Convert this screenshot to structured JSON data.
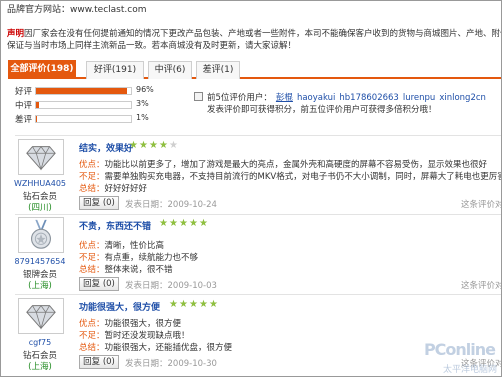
{
  "site": {
    "label": "品牌官方网站：",
    "url": "www.teclast.com"
  },
  "notice": {
    "tag": "声明",
    "line1": "因厂家会在没有任何提前通知的情况下更改产品包装、产地或者一些附件，本司不能确保客户收到的货物与商城图片、产地、附件说明完全一致",
    "line2": "保证与当时市场上同样主流新品一致。若本商城没有及时更新，请大家谅解！"
  },
  "tabs": [
    {
      "label": "全部评价(198)",
      "active": true
    },
    {
      "label": "好评(191)",
      "active": false
    },
    {
      "label": "中评(6)",
      "active": false
    },
    {
      "label": "差评(1)",
      "active": false
    }
  ],
  "ratings": [
    {
      "label": "好评",
      "percent": 96,
      "pct_text": "96%"
    },
    {
      "label": "中评",
      "percent": 3,
      "pct_text": "3%"
    },
    {
      "label": "差评",
      "percent": 1,
      "pct_text": "1%"
    }
  ],
  "top_reviewers": {
    "prefix": "前5位评价用户：",
    "users": [
      "彭棍",
      "haoyakui",
      "hb178602663",
      "lurenpu",
      "xinlong2cn"
    ],
    "note": "发表评价即可获得积分，前五位评价用户可获得多倍积分哦！"
  },
  "reviews": [
    {
      "username": "WZHHUA405",
      "level": "钻石会员",
      "region": "(四川)",
      "title": "结实，效果好",
      "stars": 4,
      "lines": [
        {
          "k": "优点：",
          "v": "功能比以前更多了，增加了游戏是最大的亮点，金属外壳和高硬度的屏幕不容易受伤，显示效果也很好"
        },
        {
          "k": "不足：",
          "v": "需要单独购买充电器，不支持目前流行的MKV格式，对电子书仍不大小调制，同时，屏幕大了耗电也更厉害，续键分布需要再"
        },
        {
          "k": "总结：",
          "v": "好好好好好"
        }
      ],
      "reply": "回复 (0)",
      "date": "发表日期：2009-10-24",
      "useful": "这条评价对您"
    },
    {
      "username": "8791457654",
      "level": "银牌会员",
      "region": "(上海)",
      "title": "不贵，东西还不错",
      "stars": 5,
      "lines": [
        {
          "k": "优点：",
          "v": "清晰，性价比高"
        },
        {
          "k": "不足：",
          "v": "有点重，续航能力也不够"
        },
        {
          "k": "总结：",
          "v": "整体来说，很不错"
        }
      ],
      "reply": "回复 (0)",
      "date": "发表日期：2009-10-03",
      "useful": "这条评价对您"
    },
    {
      "username": "cgf75",
      "level": "钻石会员",
      "region": "(上海)",
      "title": "功能很强大，很方便",
      "stars": 5,
      "lines": [
        {
          "k": "优点：",
          "v": "功能很强大，很方便"
        },
        {
          "k": "不足：",
          "v": "暂时还没发现缺点哦！"
        },
        {
          "k": "总结：",
          "v": "功能很强大，还能插优盘，很方便"
        }
      ],
      "reply": "回复 (0)",
      "date": "发表日期：2009-10-30",
      "useful": "这条评价对您"
    }
  ],
  "watermark": {
    "brand": "PConline",
    "sub": "太平洋电脑网"
  },
  "colors": {
    "accent": "#e4580e",
    "link": "#1f4fa8",
    "star": "#8fbf3f",
    "region": "#228b22"
  }
}
